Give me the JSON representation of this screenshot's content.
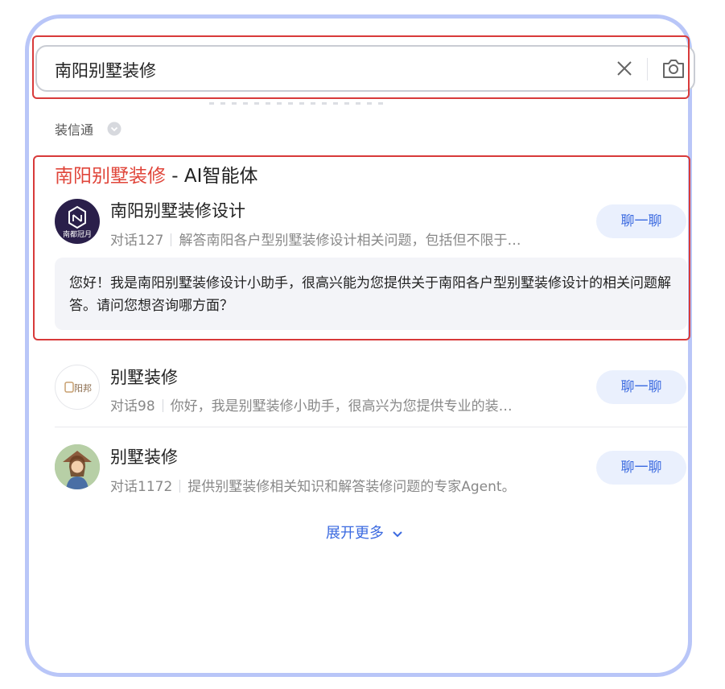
{
  "search": {
    "query": "南阳别墅装修"
  },
  "source": {
    "label": "装信通"
  },
  "section": {
    "title_highlight": "南阳别墅装修",
    "title_rest": " - AI智能体"
  },
  "agents": [
    {
      "name": "南阳别墅装修设计",
      "chats": "对话127",
      "desc": "解答南阳各户型别墅装修设计相关问题，包括但不限于…",
      "button": "聊一聊",
      "greeting": "您好！我是南阳别墅装修设计小助手，很高兴能为您提供关于南阳各户型别墅装修设计的相关问题解答。请问您想咨询哪方面？",
      "logo_text": "南都冠月"
    },
    {
      "name": "别墅装修",
      "chats": "对话98",
      "desc": "你好，我是别墅装修小助手，很高兴为您提供专业的装…",
      "button": "聊一聊",
      "logo_text": "阳邦"
    },
    {
      "name": "别墅装修",
      "chats": "对话1172",
      "desc": "提供别墅装修相关知识和解答装修问题的专家Agent。",
      "button": "聊一聊"
    }
  ],
  "more": {
    "label": "展开更多"
  },
  "colors": {
    "accent": "#3b6ae0",
    "highlight": "#e0453a",
    "frame": "#b9c6f8",
    "annotation": "#d83a3a"
  }
}
